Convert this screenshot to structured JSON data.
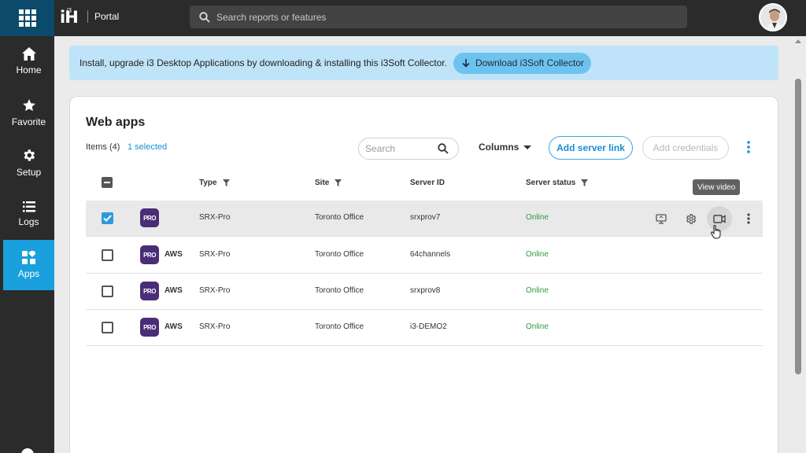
{
  "topbar": {
    "logo": "iH",
    "logo_sup": "i3",
    "portal_label": "Portal",
    "search_placeholder": "Search reports or features"
  },
  "sidebar": {
    "items": [
      {
        "label": "Home",
        "icon": "home-icon"
      },
      {
        "label": "Favorite",
        "icon": "star-icon"
      },
      {
        "label": "Setup",
        "icon": "gear-icon"
      },
      {
        "label": "Logs",
        "icon": "list-icon"
      },
      {
        "label": "Apps",
        "icon": "apps-icon",
        "active": true
      }
    ]
  },
  "banner": {
    "text": "Install, upgrade i3 Desktop Applications by downloading & installing this i3Soft Collector.",
    "button_label": "Download i3Soft Collector"
  },
  "card": {
    "title": "Web apps",
    "items_count": "Items (4)",
    "selected_count": "1 selected",
    "search_placeholder": "Search",
    "columns_label": "Columns",
    "add_server_label": "Add server link",
    "add_credentials_label": "Add credentials"
  },
  "table": {
    "headers": {
      "type": "Type",
      "site": "Site",
      "server_id": "Server ID",
      "server_status": "Server status"
    },
    "rows": [
      {
        "badge": "PRO",
        "provider": "",
        "type": "SRX-Pro",
        "site": "Toronto Office",
        "server_id": "srxprov7",
        "status": "Online",
        "selected": true
      },
      {
        "badge": "PRO",
        "provider": "AWS",
        "type": "SRX-Pro",
        "site": "Toronto Office",
        "server_id": "64channels",
        "status": "Online",
        "selected": false
      },
      {
        "badge": "PRO",
        "provider": "AWS",
        "type": "SRX-Pro",
        "site": "Toronto Office",
        "server_id": "srxprov8",
        "status": "Online",
        "selected": false
      },
      {
        "badge": "PRO",
        "provider": "AWS",
        "type": "SRX-Pro",
        "site": "Toronto Office",
        "server_id": "i3-DEMO2",
        "status": "Online",
        "selected": false
      }
    ]
  },
  "tooltip": {
    "text": "View video"
  },
  "colors": {
    "accent": "#1aa0dc",
    "topbar": "#2b2b2b",
    "banner": "#bfe3f8",
    "online": "#2f9a3e",
    "badge": "#4a2d77"
  }
}
